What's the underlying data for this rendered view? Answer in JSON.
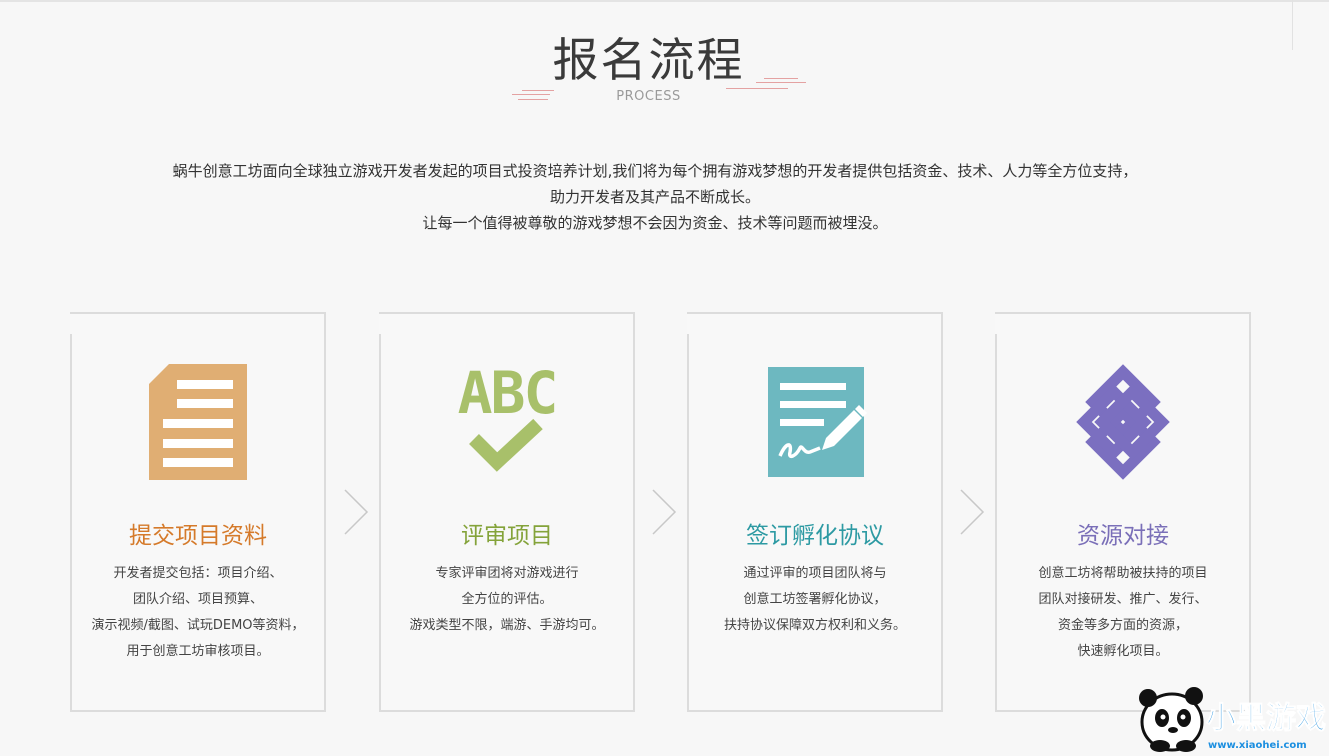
{
  "header": {
    "title": "报名流程",
    "subtitle": "PROCESS"
  },
  "intro": {
    "lines": [
      "蜗牛创意工坊面向全球独立游戏开发者发起的项目式投资培养计划,我们将为每个拥有游戏梦想的开发者提供包括资金、技术、人力等全方位支持，",
      "助力开发者及其产品不断成长。",
      "让每一个值得被尊敬的游戏梦想不会因为资金、技术等问题而被埋没。"
    ]
  },
  "colors": {
    "step1": "#d57a2a",
    "step2": "#84a33a",
    "step3": "#2d9aa3",
    "step4": "#7a6fb8",
    "icon1": "#e0ae73",
    "icon2": "#a8c06a",
    "icon3": "#6db8c0",
    "icon4": "#7b6fc0"
  },
  "steps": [
    {
      "title": "提交项目资料",
      "icon": "document-icon",
      "desc": [
        "开发者提交包括：项目介绍、",
        "团队介绍、项目预算、",
        "演示视频/截图、试玩DEMO等资料，",
        "用于创意工坊审核项目。"
      ]
    },
    {
      "title": "评审项目",
      "icon": "abc-check-icon",
      "icon_text": "ABC",
      "desc": [
        "专家评审团将对游戏进行",
        "全方位的评估。",
        "游戏类型不限，端游、手游均可。"
      ]
    },
    {
      "title": "签订孵化协议",
      "icon": "contract-sign-icon",
      "desc": [
        "通过评审的项目团队将与",
        "创意工坊签署孵化协议，",
        "扶持协议保障双方权利和义务。"
      ]
    },
    {
      "title": "资源对接",
      "icon": "exchange-icon",
      "desc": [
        "创意工坊将帮助被扶持的项目",
        "团队对接研发、推广、发行、",
        "资金等多方面的资源，",
        "快速孵化项目。"
      ]
    }
  ],
  "watermark": {
    "brand": "小黑游戏",
    "url": "www.xiaohei.com"
  }
}
